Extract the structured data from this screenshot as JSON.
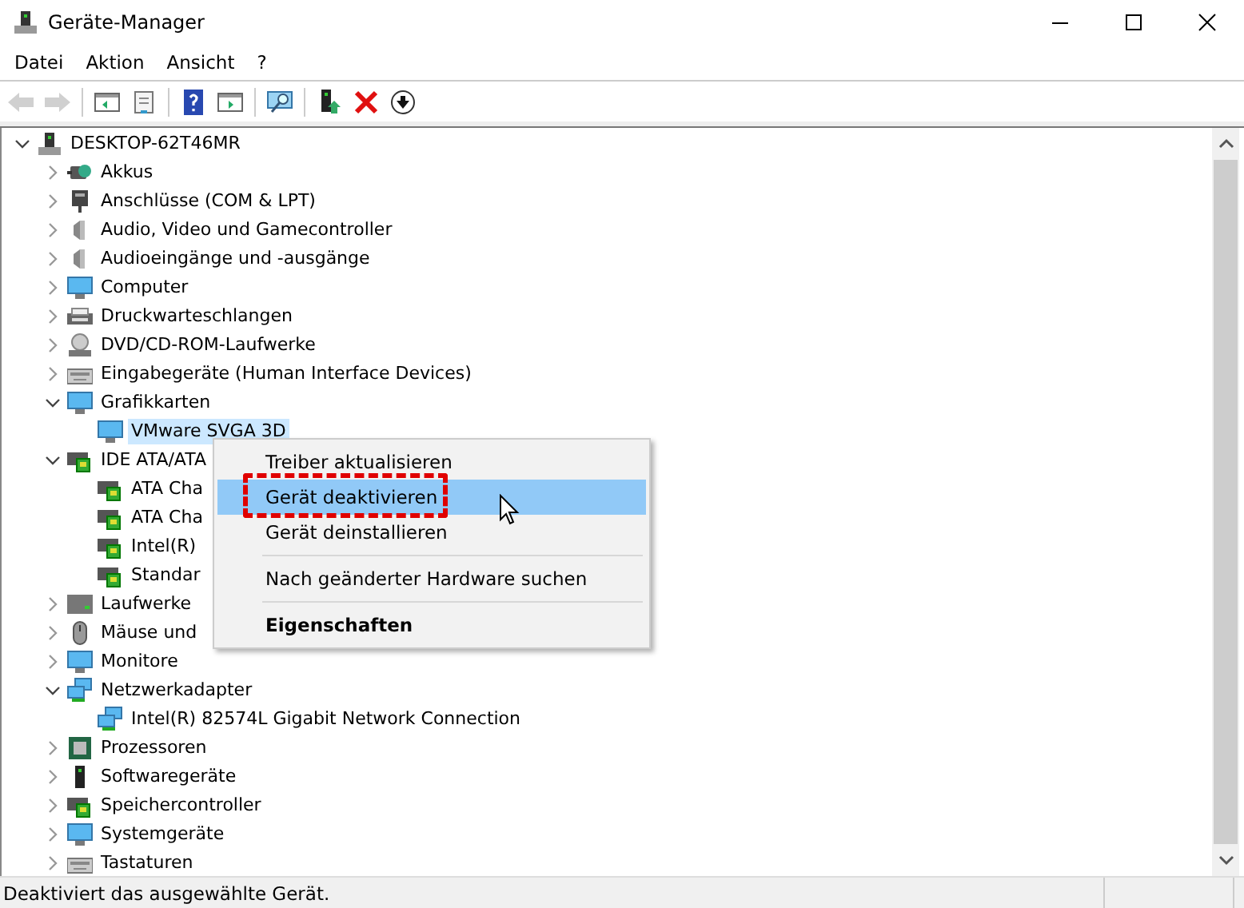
{
  "window": {
    "title": "Geräte-Manager"
  },
  "menu_bar": [
    "Datei",
    "Aktion",
    "Ansicht",
    "?"
  ],
  "toolbar": [
    {
      "disabled": true
    },
    {
      "disabled": true
    },
    {
      "disabled": false
    },
    {
      "disabled": false
    },
    {
      "disabled": false
    },
    {
      "disabled": false
    },
    {
      "disabled": false
    },
    {
      "disabled": false
    },
    {
      "disabled": false
    },
    {
      "disabled": false
    }
  ],
  "tree": {
    "label": "DESKTOP-62T46MR",
    "expanded": true,
    "selected": false,
    "children": [
      {
        "label": "Akkus",
        "expanded": false,
        "selected": false
      },
      {
        "label": "Anschlüsse (COM & LPT)",
        "expanded": false,
        "selected": false
      },
      {
        "label": "Audio, Video und Gamecontroller",
        "expanded": false,
        "selected": false
      },
      {
        "label": "Audioeingänge und -ausgänge",
        "expanded": false,
        "selected": false
      },
      {
        "label": "Computer",
        "expanded": false,
        "selected": false
      },
      {
        "label": "Druckwarteschlangen",
        "expanded": false,
        "selected": false
      },
      {
        "label": "DVD/CD-ROM-Laufwerke",
        "expanded": false,
        "selected": false
      },
      {
        "label": "Eingabegeräte (Human Interface Devices)",
        "expanded": false,
        "selected": false
      },
      {
        "label": "Grafikkarten",
        "expanded": true,
        "selected": false,
        "children": [
          {
            "label": "VMware SVGA 3D",
            "selected": true
          }
        ]
      },
      {
        "label": "IDE ATA/ATA",
        "expanded": true,
        "selected": false,
        "children": [
          {
            "label": "ATA Cha",
            "selected": false
          },
          {
            "label": "ATA Cha",
            "selected": false
          },
          {
            "label": "Intel(R)",
            "selected": false
          },
          {
            "label": "Standar",
            "selected": false
          }
        ]
      },
      {
        "label": "Laufwerke",
        "expanded": false,
        "selected": false
      },
      {
        "label": "Mäuse und",
        "expanded": false,
        "selected": false
      },
      {
        "label": "Monitore",
        "expanded": false,
        "selected": false
      },
      {
        "label": "Netzwerkadapter",
        "expanded": true,
        "selected": false,
        "children": [
          {
            "label": "Intel(R) 82574L Gigabit Network Connection",
            "selected": false
          }
        ]
      },
      {
        "label": "Prozessoren",
        "expanded": false,
        "selected": false
      },
      {
        "label": "Softwaregeräte",
        "expanded": false,
        "selected": false
      },
      {
        "label": "Speichercontroller",
        "expanded": false,
        "selected": false
      },
      {
        "label": "Systemgeräte",
        "expanded": false,
        "selected": false
      },
      {
        "label": "Tastaturen",
        "expanded": false,
        "selected": false
      }
    ]
  },
  "context_menu": {
    "items": [
      {
        "kind": "item",
        "label": "Treiber aktualisieren",
        "selected": false
      },
      {
        "kind": "item",
        "label": "Gerät deaktivieren",
        "selected": true
      },
      {
        "kind": "item",
        "label": "Gerät deinstallieren",
        "selected": false
      },
      {
        "kind": "separator"
      },
      {
        "kind": "item",
        "label": "Nach geänderter Hardware suchen",
        "selected": false
      },
      {
        "kind": "separator"
      },
      {
        "kind": "default",
        "label": "Eigenschaften",
        "selected": false
      }
    ]
  },
  "status_bar": "Deaktiviert das ausgewählte Gerät."
}
